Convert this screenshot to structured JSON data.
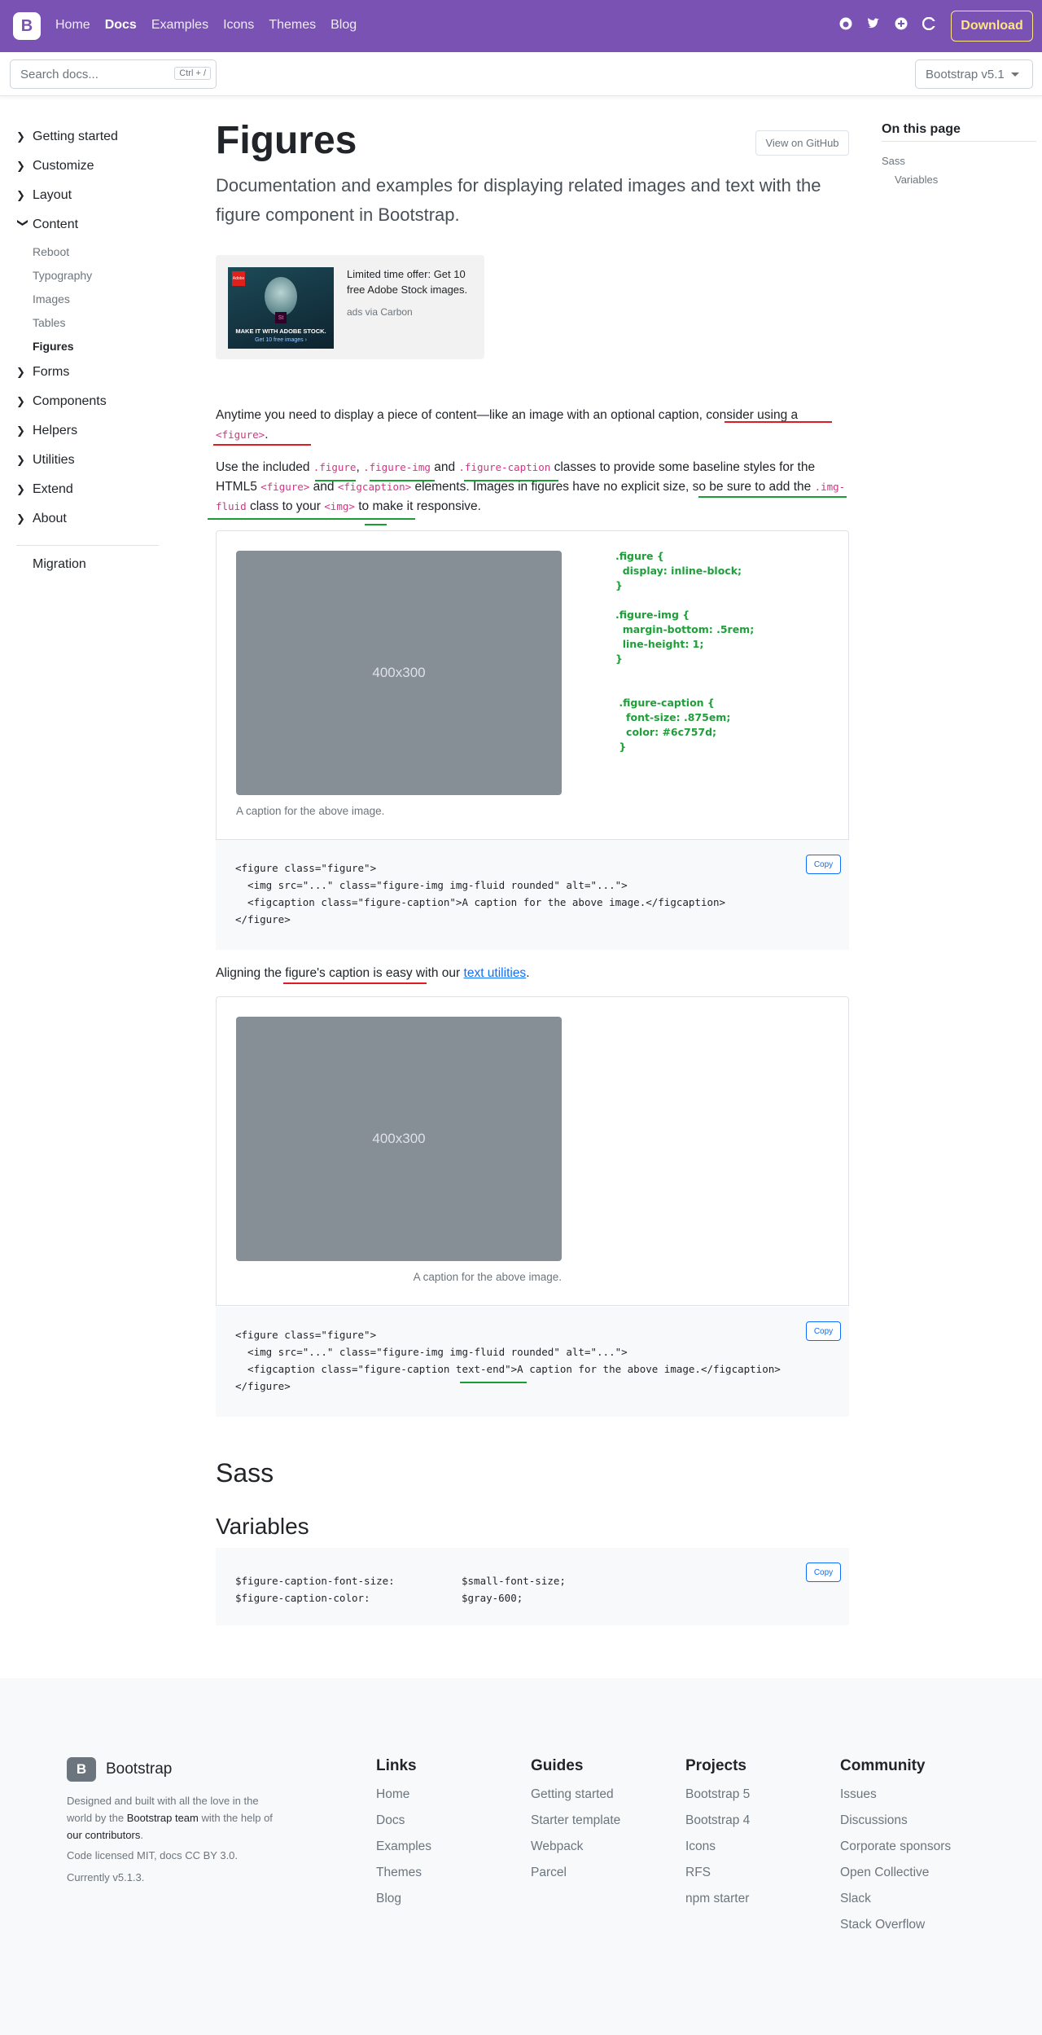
{
  "navbar": {
    "brand": "B",
    "links": [
      "Home",
      "Docs",
      "Examples",
      "Icons",
      "Themes",
      "Blog"
    ],
    "active": "Docs",
    "socials": [
      "github-icon",
      "twitter-icon",
      "slack-icon",
      "opencollective-icon"
    ],
    "download": "Download"
  },
  "subnav": {
    "search_placeholder": "Search docs...",
    "search_shortcut": "Ctrl + /",
    "version": "Bootstrap v5.1"
  },
  "sidebar": {
    "groups": [
      {
        "label": "Getting started",
        "expanded": false
      },
      {
        "label": "Customize",
        "expanded": false
      },
      {
        "label": "Layout",
        "expanded": false
      },
      {
        "label": "Content",
        "expanded": true,
        "items": [
          "Reboot",
          "Typography",
          "Images",
          "Tables",
          "Figures"
        ]
      },
      {
        "label": "Forms",
        "expanded": false
      },
      {
        "label": "Components",
        "expanded": false
      },
      {
        "label": "Helpers",
        "expanded": false
      },
      {
        "label": "Utilities",
        "expanded": false
      },
      {
        "label": "Extend",
        "expanded": false
      },
      {
        "label": "About",
        "expanded": false
      }
    ],
    "active_item": "Figures",
    "migration": "Migration"
  },
  "toc": {
    "title": "On this page",
    "items": [
      "Sass",
      "Variables"
    ]
  },
  "main": {
    "title": "Figures",
    "github_button": "View on GitHub",
    "lead": "Documentation and examples for displaying related images and text with the figure component in Bootstrap.",
    "ad": {
      "logo": "Adobe",
      "ps": "St",
      "tagline": "MAKE IT WITH ADOBE STOCK.",
      "cta": "Get 10 free images ›",
      "text": "Limited time offer: Get 10 free Adobe Stock images.",
      "via": "ads via Carbon"
    },
    "p1": {
      "a": "Anytime you need to display a piece of content—like an image with an optional caption, consider using a ",
      "code": "<figure>",
      "b": "."
    },
    "p2": {
      "t1": "Use the included ",
      "c1": ".figure",
      "t2": ", ",
      "c2": ".figure-img",
      "t3": " and ",
      "c3": ".figure-caption",
      "t4": " classes to provide some baseline styles for the HTML5 ",
      "c4": "<figure>",
      "t5": " and ",
      "c5": "<figcaption>",
      "t6": " elements. Images in figures have no explicit size, so be sure to add the ",
      "c6": ".img-fluid",
      "t7": " class to your ",
      "c7": "<img>",
      "t8": " to make it responsive."
    },
    "example1": {
      "placeholder": "400x300",
      "caption": "A caption for the above image.",
      "css_note": ".figure {\n  display: inline-block;\n}\n\n.figure-img {\n  margin-bottom: .5rem;\n  line-height: 1;\n}\n\n\n .figure-caption {\n   font-size: .875em;\n   color: #6c757d;\n }"
    },
    "code1": [
      "<figure class=\"figure\">",
      "  <img src=\"...\" class=\"figure-img img-fluid rounded\" alt=\"...\">",
      "  <figcaption class=\"figure-caption\">A caption for the above image.</figcaption>",
      "</figure>"
    ],
    "copy": "Copy",
    "p3": {
      "a": "Aligning the figure's caption is easy with our ",
      "link": "text utilities",
      "b": "."
    },
    "example2": {
      "placeholder": "400x300",
      "caption": "A caption for the above image."
    },
    "code2": [
      "<figure class=\"figure\">",
      "  <img src=\"...\" class=\"figure-img img-fluid rounded\" alt=\"...\">",
      "  <figcaption class=\"figure-caption text-end\">A caption for the above image.</figcaption>",
      "</figure>"
    ],
    "sass_heading": "Sass",
    "variables_heading": "Variables",
    "variables": [
      {
        "name": "$figure-caption-font-size:",
        "value": "$small-font-size;"
      },
      {
        "name": "$figure-caption-color:",
        "value": "$gray-600;"
      }
    ]
  },
  "footer": {
    "logo": "B",
    "brand": "Bootstrap",
    "desc_a": "Designed and built with all the love in the world by the ",
    "desc_team": "Bootstrap team",
    "desc_b": " with the help of ",
    "desc_contrib": "our contributors",
    "desc_c": ".",
    "license": "Code licensed MIT, docs CC BY 3.0.",
    "current": "Currently v5.1.3.",
    "columns": [
      {
        "title": "Links",
        "items": [
          "Home",
          "Docs",
          "Examples",
          "Themes",
          "Blog"
        ]
      },
      {
        "title": "Guides",
        "items": [
          "Getting started",
          "Starter template",
          "Webpack",
          "Parcel"
        ]
      },
      {
        "title": "Projects",
        "items": [
          "Bootstrap 5",
          "Bootstrap 4",
          "Icons",
          "RFS",
          "npm starter"
        ]
      },
      {
        "title": "Community",
        "items": [
          "Issues",
          "Discussions",
          "Corporate sponsors",
          "Open Collective",
          "Slack",
          "Stack Overflow"
        ]
      }
    ]
  },
  "annotation_colors": {
    "red": "#e01b24",
    "green": "#1a9e34",
    "css_note": "#1f9e3a"
  }
}
